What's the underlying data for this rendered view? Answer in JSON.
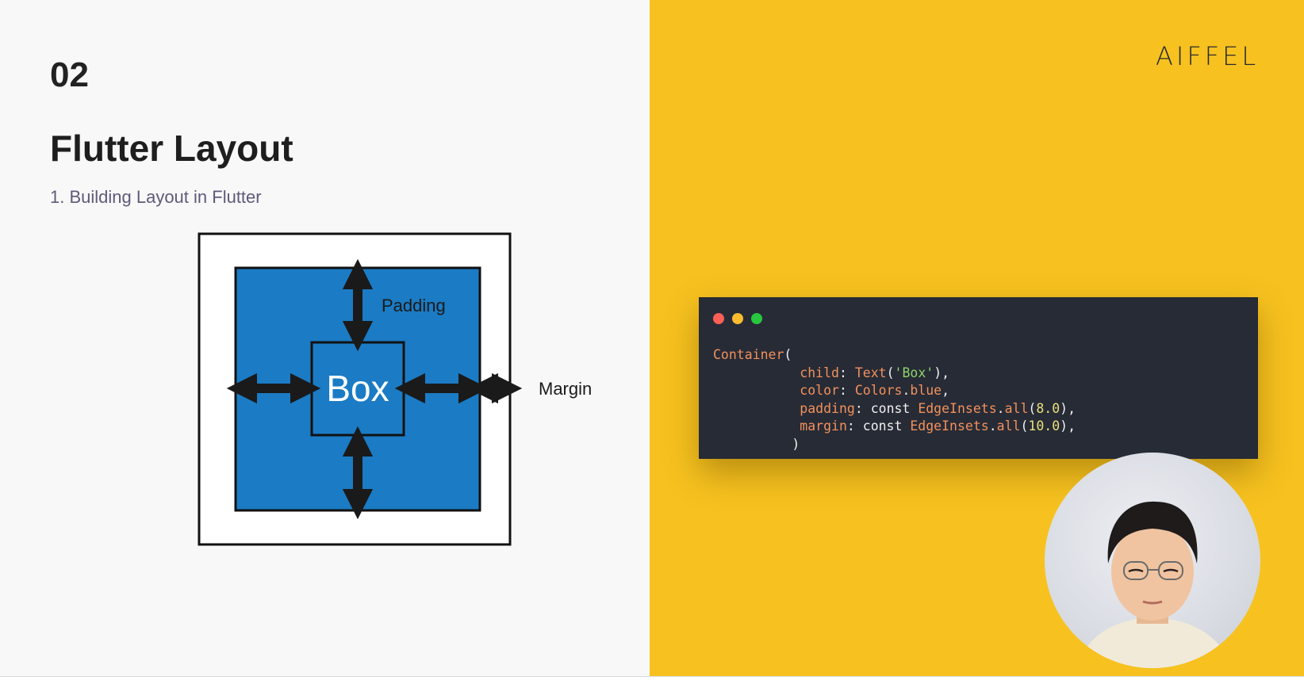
{
  "slide": {
    "section_number": "02",
    "title": "Flutter Layout",
    "subtitle": "1. Building Layout in Flutter",
    "logo": "AIFFEL"
  },
  "diagram": {
    "box_label": "Box",
    "padding_label": "Padding",
    "margin_label": "Margin",
    "box_color": "#1b7bc4"
  },
  "code_window": {
    "window_buttons": [
      "close",
      "minimize",
      "maximize"
    ],
    "lines": [
      {
        "indent": "",
        "parts": [
          {
            "t": "Container",
            "k": "kw"
          },
          {
            "t": "(",
            "k": "plain"
          }
        ]
      },
      {
        "indent": "           ",
        "parts": [
          {
            "t": "child",
            "k": "kw"
          },
          {
            "t": ": ",
            "k": "plain"
          },
          {
            "t": "Text",
            "k": "kw"
          },
          {
            "t": "(",
            "k": "plain"
          },
          {
            "t": "'Box'",
            "k": "str"
          },
          {
            "t": "),",
            "k": "plain"
          }
        ]
      },
      {
        "indent": "           ",
        "parts": [
          {
            "t": "color",
            "k": "kw"
          },
          {
            "t": ": ",
            "k": "plain"
          },
          {
            "t": "Colors",
            "k": "kw"
          },
          {
            "t": ".",
            "k": "plain"
          },
          {
            "t": "blue",
            "k": "kw"
          },
          {
            "t": ",",
            "k": "plain"
          }
        ]
      },
      {
        "indent": "           ",
        "parts": [
          {
            "t": "padding",
            "k": "kw"
          },
          {
            "t": ": const ",
            "k": "plain"
          },
          {
            "t": "EdgeInsets",
            "k": "kw"
          },
          {
            "t": ".",
            "k": "plain"
          },
          {
            "t": "all",
            "k": "kw"
          },
          {
            "t": "(",
            "k": "plain"
          },
          {
            "t": "8.0",
            "k": "num"
          },
          {
            "t": "),",
            "k": "plain"
          }
        ]
      },
      {
        "indent": "           ",
        "parts": [
          {
            "t": "margin",
            "k": "kw"
          },
          {
            "t": ": const ",
            "k": "plain"
          },
          {
            "t": "EdgeInsets",
            "k": "kw"
          },
          {
            "t": ".",
            "k": "plain"
          },
          {
            "t": "all",
            "k": "kw"
          },
          {
            "t": "(",
            "k": "plain"
          },
          {
            "t": "10.0",
            "k": "num"
          },
          {
            "t": "),",
            "k": "plain"
          }
        ]
      },
      {
        "indent": "          ",
        "parts": [
          {
            "t": ")",
            "k": "plain"
          }
        ]
      }
    ]
  },
  "webcam": {
    "label": "presenter-video"
  }
}
